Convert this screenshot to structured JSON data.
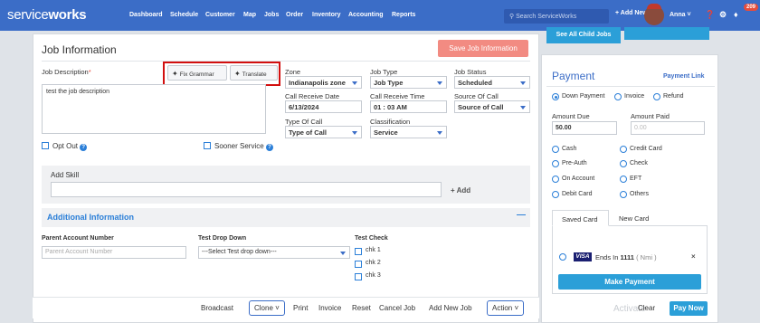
{
  "topbar": {
    "logo_prefix": "service",
    "logo_suffix": "works",
    "nav": [
      "Dashboard",
      "Schedule",
      "Customer",
      "Map",
      "Jobs",
      "Order",
      "Inventory",
      "Accounting",
      "Reports"
    ],
    "search_placeholder": "Search ServiceWorks",
    "add_new": "+ Add New",
    "user": "Anna",
    "notification_count": "209"
  },
  "job": {
    "title": "Job Information",
    "save_label": "Save Job Information",
    "description_label": "Job Description",
    "description_value": "test the job description",
    "fix_grammar": "Fix Grammar",
    "translate": "Translate",
    "zone_label": "Zone",
    "zone_value": "Indianapolis zone",
    "job_type_label": "Job Type",
    "job_type_value": "Job Type",
    "job_status_label": "Job Status",
    "job_status_value": "Scheduled",
    "call_date_label": "Call Receive Date",
    "call_date_value": "6/13/2024",
    "call_time_label": "Call Receive Time",
    "call_time_value": "01 : 03  AM",
    "source_label": "Source Of Call",
    "source_value": "Source of Call",
    "type_of_call_label": "Type Of Call",
    "type_of_call_value": "Type of Call",
    "classification_label": "Classification",
    "classification_value": "Service",
    "opt_out": "Opt Out",
    "sooner_service": "Sooner Service",
    "add_skill_label": "Add Skill",
    "add_skill_button": "+ Add"
  },
  "additional": {
    "title": "Additional Information",
    "parent_account_label": "Parent Account Number",
    "parent_account_placeholder": "Parent Account Number",
    "test_drop_label": "Test Drop Down",
    "test_drop_value": "---Select Test drop down---",
    "test_check_label": "Test Check",
    "checks": [
      "chk 1",
      "chk 2",
      "chk 3"
    ]
  },
  "bottom": {
    "broadcast": "Broadcast",
    "clone": "Clone",
    "print": "Print",
    "invoice": "Invoice",
    "reset": "Reset",
    "cancel_job": "Cancel Job",
    "add_new_job": "Add New Job",
    "action": "Action"
  },
  "payment": {
    "child_jobs": "See All Child Jobs",
    "title": "Payment",
    "link": "Payment Link",
    "mode": [
      "Down Payment",
      "Invoice",
      "Refund"
    ],
    "amount_due_label": "Amount Due",
    "amount_due_value": "50.00",
    "amount_paid_label": "Amount Paid",
    "amount_paid_placeholder": "0.00",
    "methods": [
      "Cash",
      "Credit Card",
      "Pre-Auth",
      "Check",
      "On Account",
      "EFT",
      "Debit Card",
      "Others"
    ],
    "tab_saved": "Saved Card",
    "tab_new": "New Card",
    "visa": "VISA",
    "card_ends_prefix": "Ends In ",
    "card_ends_digits": "1111",
    "card_ends_suffix": " ( Nmi )",
    "make_payment": "Make Payment",
    "activate": "Activate",
    "clear": "Clear",
    "pay_now": "Pay Now"
  }
}
